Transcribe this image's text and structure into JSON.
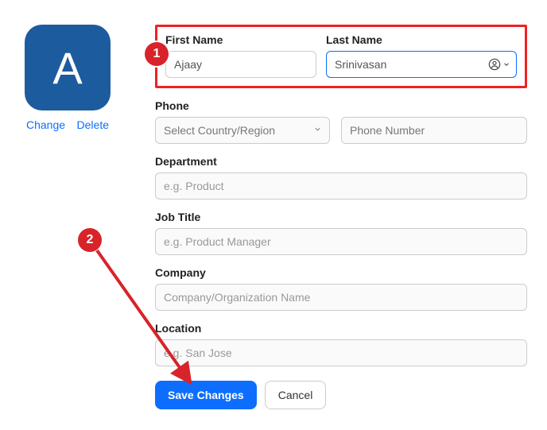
{
  "avatar": {
    "initial": "A",
    "change_label": "Change",
    "delete_label": "Delete"
  },
  "labels": {
    "first_name": "First Name",
    "last_name": "Last Name",
    "phone": "Phone",
    "department": "Department",
    "job_title": "Job Title",
    "company": "Company",
    "location": "Location"
  },
  "values": {
    "first_name": "Ajaay",
    "last_name": "Srinivasan"
  },
  "placeholders": {
    "country": "Select Country/Region",
    "phone_number": "Phone Number",
    "department": "e.g. Product",
    "job_title": "e.g. Product Manager",
    "company": "Company/Organization Name",
    "location": "e.g. San Jose"
  },
  "buttons": {
    "save": "Save Changes",
    "cancel": "Cancel"
  },
  "annotations": {
    "badge1": "1",
    "badge2": "2"
  },
  "colors": {
    "accent": "#0d6efd",
    "highlight_border": "#e22",
    "badge": "#d8232a",
    "avatar_bg": "#1c5c9e"
  }
}
